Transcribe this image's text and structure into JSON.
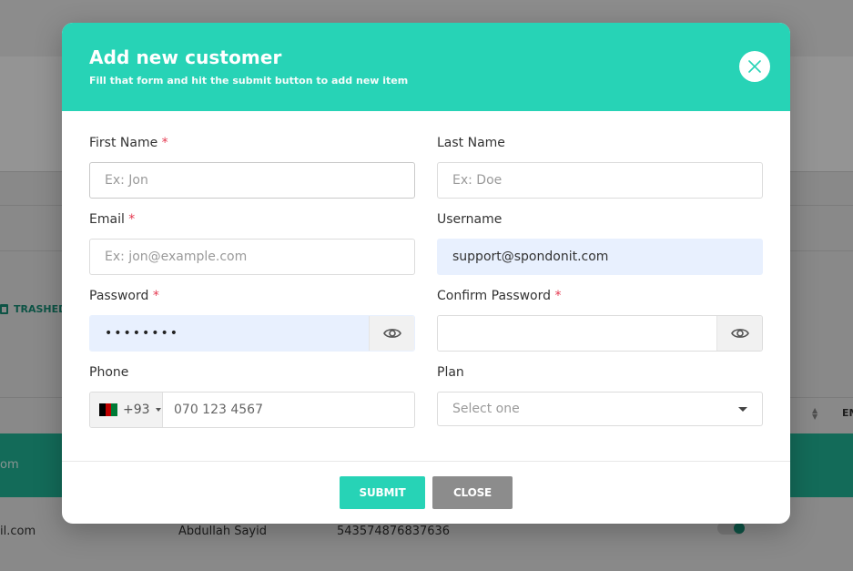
{
  "background": {
    "trashed_label": "TRASHED",
    "teal_row_text": "om",
    "row": {
      "email_fragment": "il.com",
      "name": "Abdullah Sayid",
      "number": "543574876837636"
    },
    "column_fragment": "EM"
  },
  "modal": {
    "title": "Add new customer",
    "subtitle": "Fill that form and hit the submit button to add new item",
    "close_icon": "close-icon",
    "accent_color": "#27d3b6"
  },
  "form": {
    "first_name": {
      "label": "First Name",
      "required": "*",
      "placeholder": "Ex: Jon",
      "value": ""
    },
    "last_name": {
      "label": "Last Name",
      "placeholder": "Ex: Doe",
      "value": ""
    },
    "email": {
      "label": "Email",
      "required": "*",
      "placeholder": "Ex: jon@example.com",
      "value": ""
    },
    "username": {
      "label": "Username",
      "value": "support@spondonit.com"
    },
    "password": {
      "label": "Password",
      "required": "*",
      "value": "••••••••",
      "toggle_icon": "eye-icon"
    },
    "confirm_password": {
      "label": "Confirm Password",
      "required": "*",
      "value": "",
      "toggle_icon": "eye-icon"
    },
    "phone": {
      "label": "Phone",
      "country_code": "+93",
      "country_flag": "afghanistan-flag-icon",
      "placeholder": "070 123 4567"
    },
    "plan": {
      "label": "Plan",
      "selected": "Select one"
    }
  },
  "footer": {
    "submit_label": "SUBMIT",
    "close_label": "CLOSE",
    "close_color": "#8c8c8c"
  }
}
